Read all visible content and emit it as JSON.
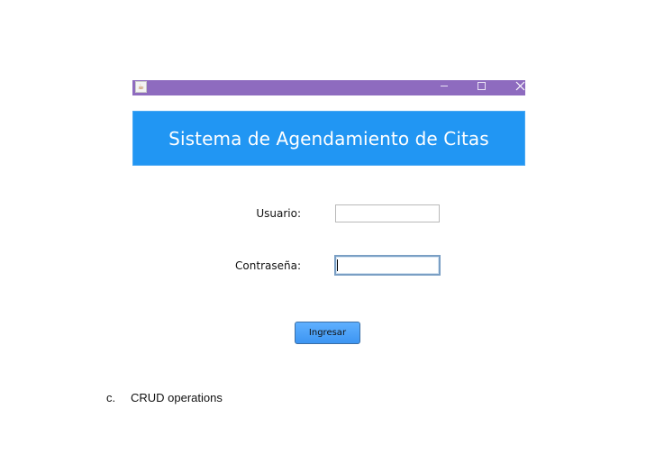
{
  "window": {
    "icon": "java-cup-icon",
    "controls": [
      "minimize-icon",
      "maximize-icon",
      "close-icon"
    ],
    "titlebar_color": "#8e6bbf"
  },
  "banner": {
    "title": "Sistema de Agendamiento de Citas",
    "color": "#2196f3"
  },
  "form": {
    "username_label": "Usuario:",
    "username_value": "",
    "password_label": "Contraseña:",
    "password_value": "",
    "submit_label": "Ingresar"
  },
  "document": {
    "list_marker": "c.",
    "list_text": "CRUD operations"
  }
}
